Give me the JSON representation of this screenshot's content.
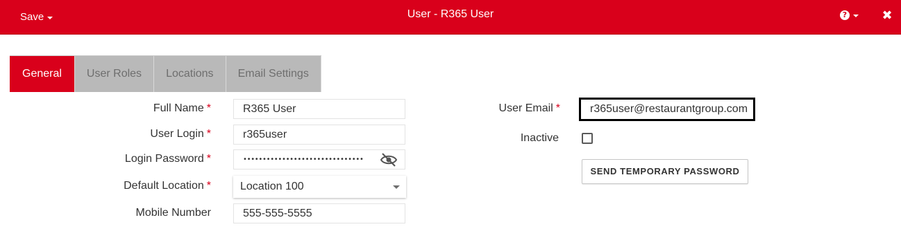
{
  "header": {
    "save_label": "Save",
    "title": "User - R365 User",
    "help_icon_glyph": "?",
    "close_icon_glyph": "✖",
    "background_color": "#d9001b"
  },
  "tabs": [
    {
      "label": "General",
      "active": true
    },
    {
      "label": "User Roles",
      "active": false
    },
    {
      "label": "Locations",
      "active": false
    },
    {
      "label": "Email Settings",
      "active": false
    }
  ],
  "form": {
    "required_marker": "*",
    "full_name": {
      "label": "Full Name",
      "value": "R365 User"
    },
    "user_login": {
      "label": "User Login",
      "value": "r365user"
    },
    "login_password": {
      "label": "Login Password",
      "masked_value": "•••••••••••••••••••••••••••••••"
    },
    "default_location": {
      "label": "Default Location",
      "value": "Location 100"
    },
    "mobile_number": {
      "label": "Mobile Number",
      "value": "555-555-5555"
    },
    "user_email": {
      "label": "User Email",
      "value": "r365user@restaurantgroup.com"
    },
    "inactive": {
      "label": "Inactive",
      "checked": false
    },
    "send_temp_password_label": "SEND TEMPORARY PASSWORD"
  },
  "colors": {
    "accent": "#d9001b",
    "tab_inactive": "#b9b9b9",
    "tab_inactive_text": "#6e6e6e"
  }
}
